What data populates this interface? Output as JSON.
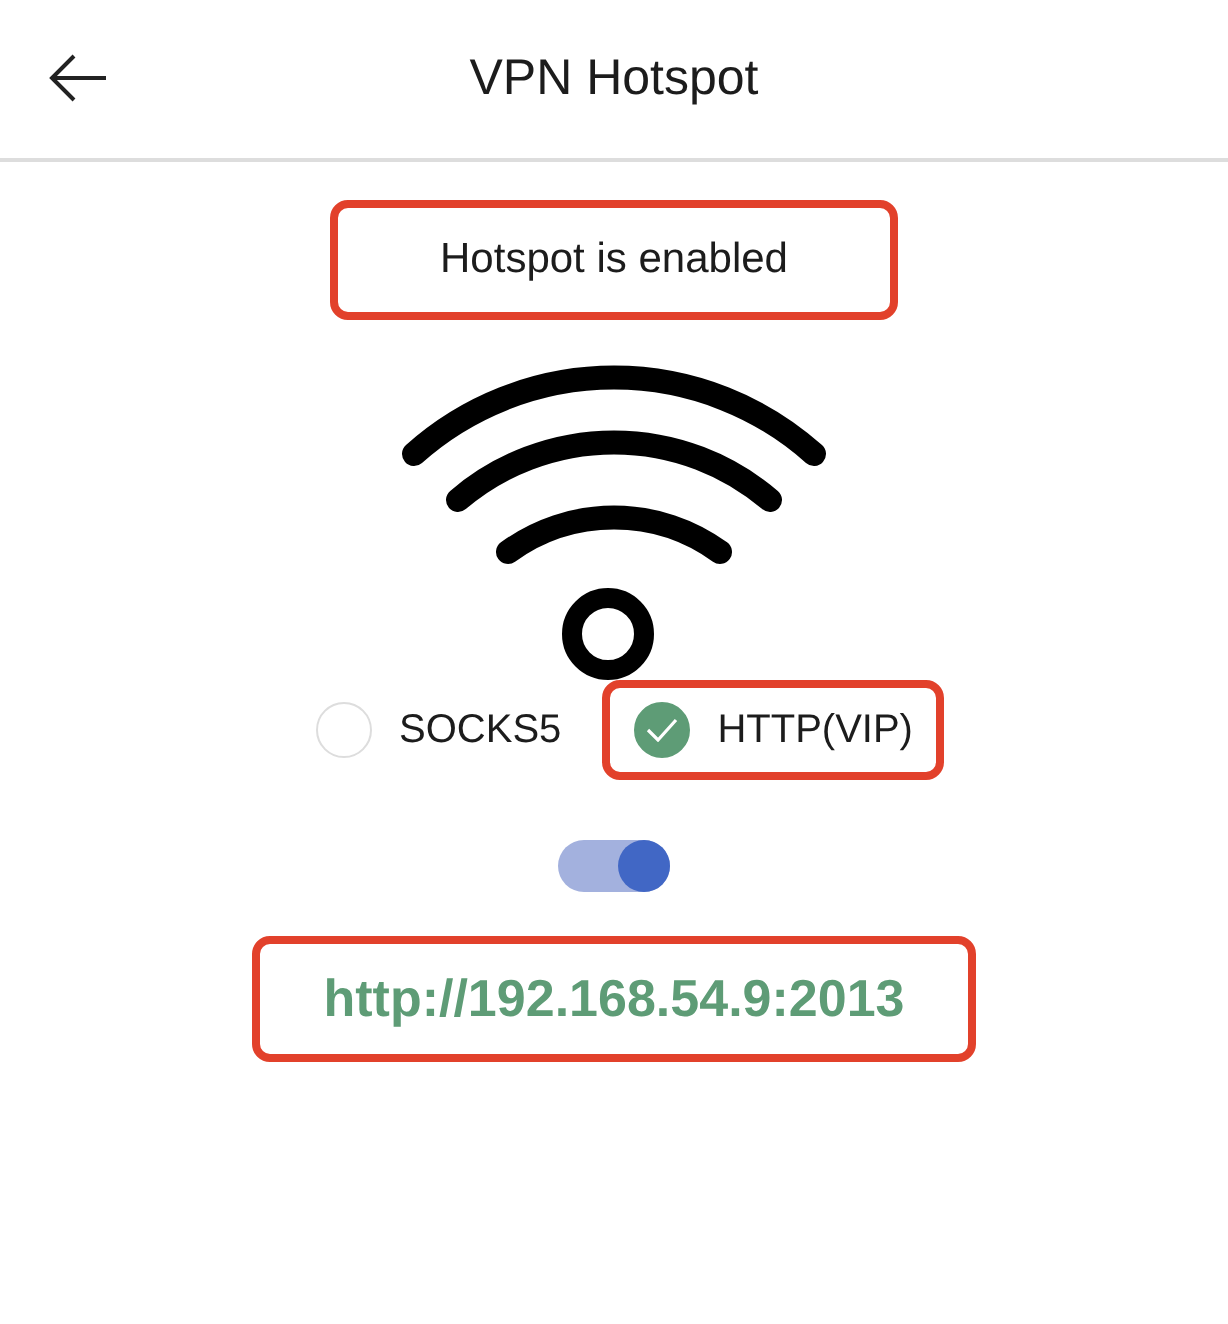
{
  "app_bar": {
    "title": "VPN Hotspot"
  },
  "status": {
    "text": "Hotspot is enabled",
    "highlighted": true
  },
  "protocols": [
    {
      "label": "SOCKS5",
      "selected": false,
      "highlighted": false
    },
    {
      "label": "HTTP(VIP)",
      "selected": true,
      "highlighted": true
    }
  ],
  "hotspot_switch": {
    "on": true
  },
  "address": {
    "text": "http://192.168.54.9:2013",
    "highlighted": true
  }
}
